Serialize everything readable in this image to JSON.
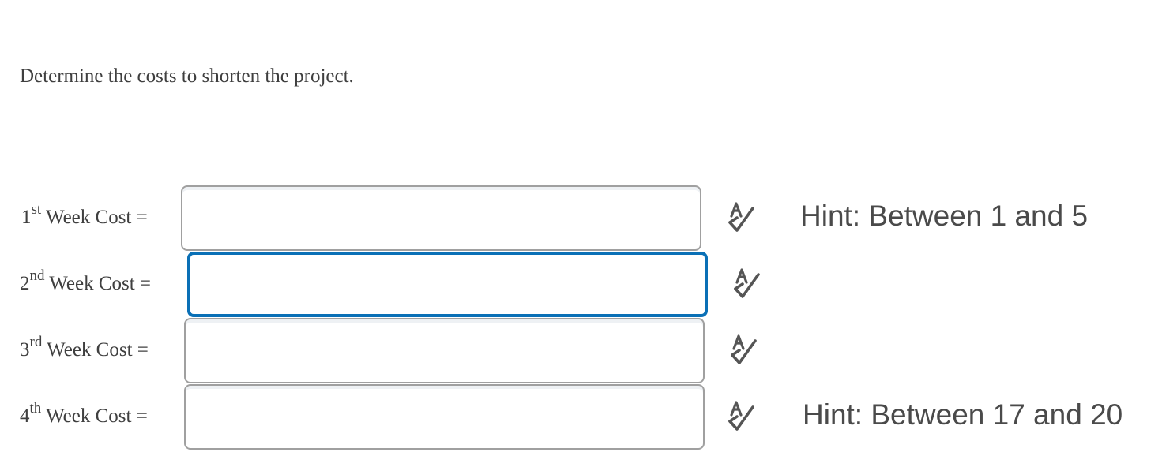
{
  "question": {
    "instruction": "Determine the costs to shorten the project."
  },
  "rows": [
    {
      "label_number": "1",
      "label_suffix": "st",
      "label_rest": " Week Cost =",
      "value": "",
      "hint": "Hint: Between 1 and 5",
      "spellcheck_icon": "spellcheck-icon"
    },
    {
      "label_number": "2",
      "label_suffix": "nd",
      "label_rest": " Week Cost =",
      "value": "",
      "hint": "",
      "spellcheck_icon": "spellcheck-icon"
    },
    {
      "label_number": "3",
      "label_suffix": "rd",
      "label_rest": " Week Cost =",
      "value": "",
      "hint": "",
      "spellcheck_icon": "spellcheck-icon"
    },
    {
      "label_number": "4",
      "label_suffix": "th",
      "label_rest": " Week Cost =",
      "value": "",
      "hint": "Hint: Between 17 and 20",
      "spellcheck_icon": "spellcheck-icon"
    }
  ],
  "colors": {
    "focus_border": "#0a70b6",
    "input_border": "#a0a0a0",
    "text": "#3f3f3f"
  }
}
